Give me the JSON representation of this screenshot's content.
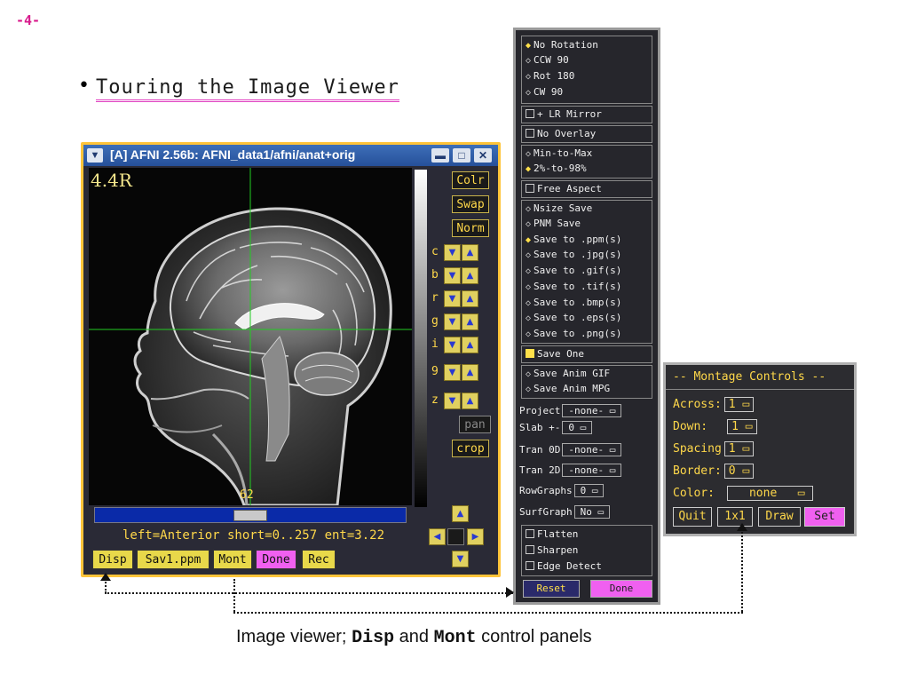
{
  "page_number": "-4-",
  "heading": "Touring the Image Viewer",
  "viewer": {
    "title": "[A] AFNI 2.56b: AFNI_data1/afni/anat+orig",
    "coord": "4.4R",
    "side_buttons": [
      "Colr",
      "Swap",
      "Norm"
    ],
    "arrow_rows": [
      "c",
      "b",
      "r",
      "g",
      "i",
      "9",
      "z"
    ],
    "pan_label": "pan",
    "crop_label": "crop",
    "slice_number": "62",
    "info": "left=Anterior short=0..257 ent=3.22",
    "bottom_buttons": [
      "Disp",
      "Sav1.ppm",
      "Mont",
      "Done",
      "Rec"
    ]
  },
  "disp": {
    "rotation": [
      "No Rotation",
      "CCW 90",
      "Rot 180",
      "CW 90"
    ],
    "mirror": "+ LR Mirror",
    "overlay": "No Overlay",
    "scaling": [
      "Min-to-Max",
      "2%-to-98%"
    ],
    "aspect": "Free Aspect",
    "save_opts": [
      "Nsize Save",
      "PNM Save"
    ],
    "save_formats": [
      "Save to .ppm(s)",
      "Save to .jpg(s)",
      "Save to .gif(s)",
      "Save to .tif(s)",
      "Save to .bmp(s)",
      "Save to .eps(s)",
      "Save to .png(s)"
    ],
    "save_one": "Save One",
    "anim": [
      "Save Anim GIF",
      "Save Anim MPG"
    ],
    "project_label": "Project",
    "project_value": "-none-",
    "slab_label": "Slab +-",
    "slab_value": "0",
    "tran0d_label": "Tran 0D",
    "tran0d_value": "-none-",
    "tran2d_label": "Tran 2D",
    "tran2d_value": "-none-",
    "rowgraphs_label": "RowGraphs",
    "rowgraphs_value": "0",
    "surfgraph_label": "SurfGraph",
    "surfgraph_value": "No",
    "filters": [
      "Flatten",
      "Sharpen",
      "Edge Detect"
    ],
    "reset": "Reset",
    "done": "Done"
  },
  "mont": {
    "title": "-- Montage Controls --",
    "across_label": "Across:",
    "across_value": "1",
    "down_label": "Down:",
    "down_value": "1",
    "spacing_label": "Spacing",
    "spacing_value": "1",
    "border_label": "Border:",
    "border_value": "0",
    "color_label": "Color:",
    "color_value": "none",
    "buttons": [
      "Quit",
      "1x1",
      "Draw",
      "Set"
    ]
  },
  "caption": {
    "pre": "Image viewer; ",
    "disp": "Disp",
    "mid": " and ",
    "mont": "Mont",
    "post": " control panels"
  },
  "colors": {
    "accent": "#d81b8c",
    "viewer_frame": "#ffc43a",
    "button_yellow": "#e8d84a",
    "done_magenta": "#f060f0",
    "crosshair": "#22cc22"
  }
}
